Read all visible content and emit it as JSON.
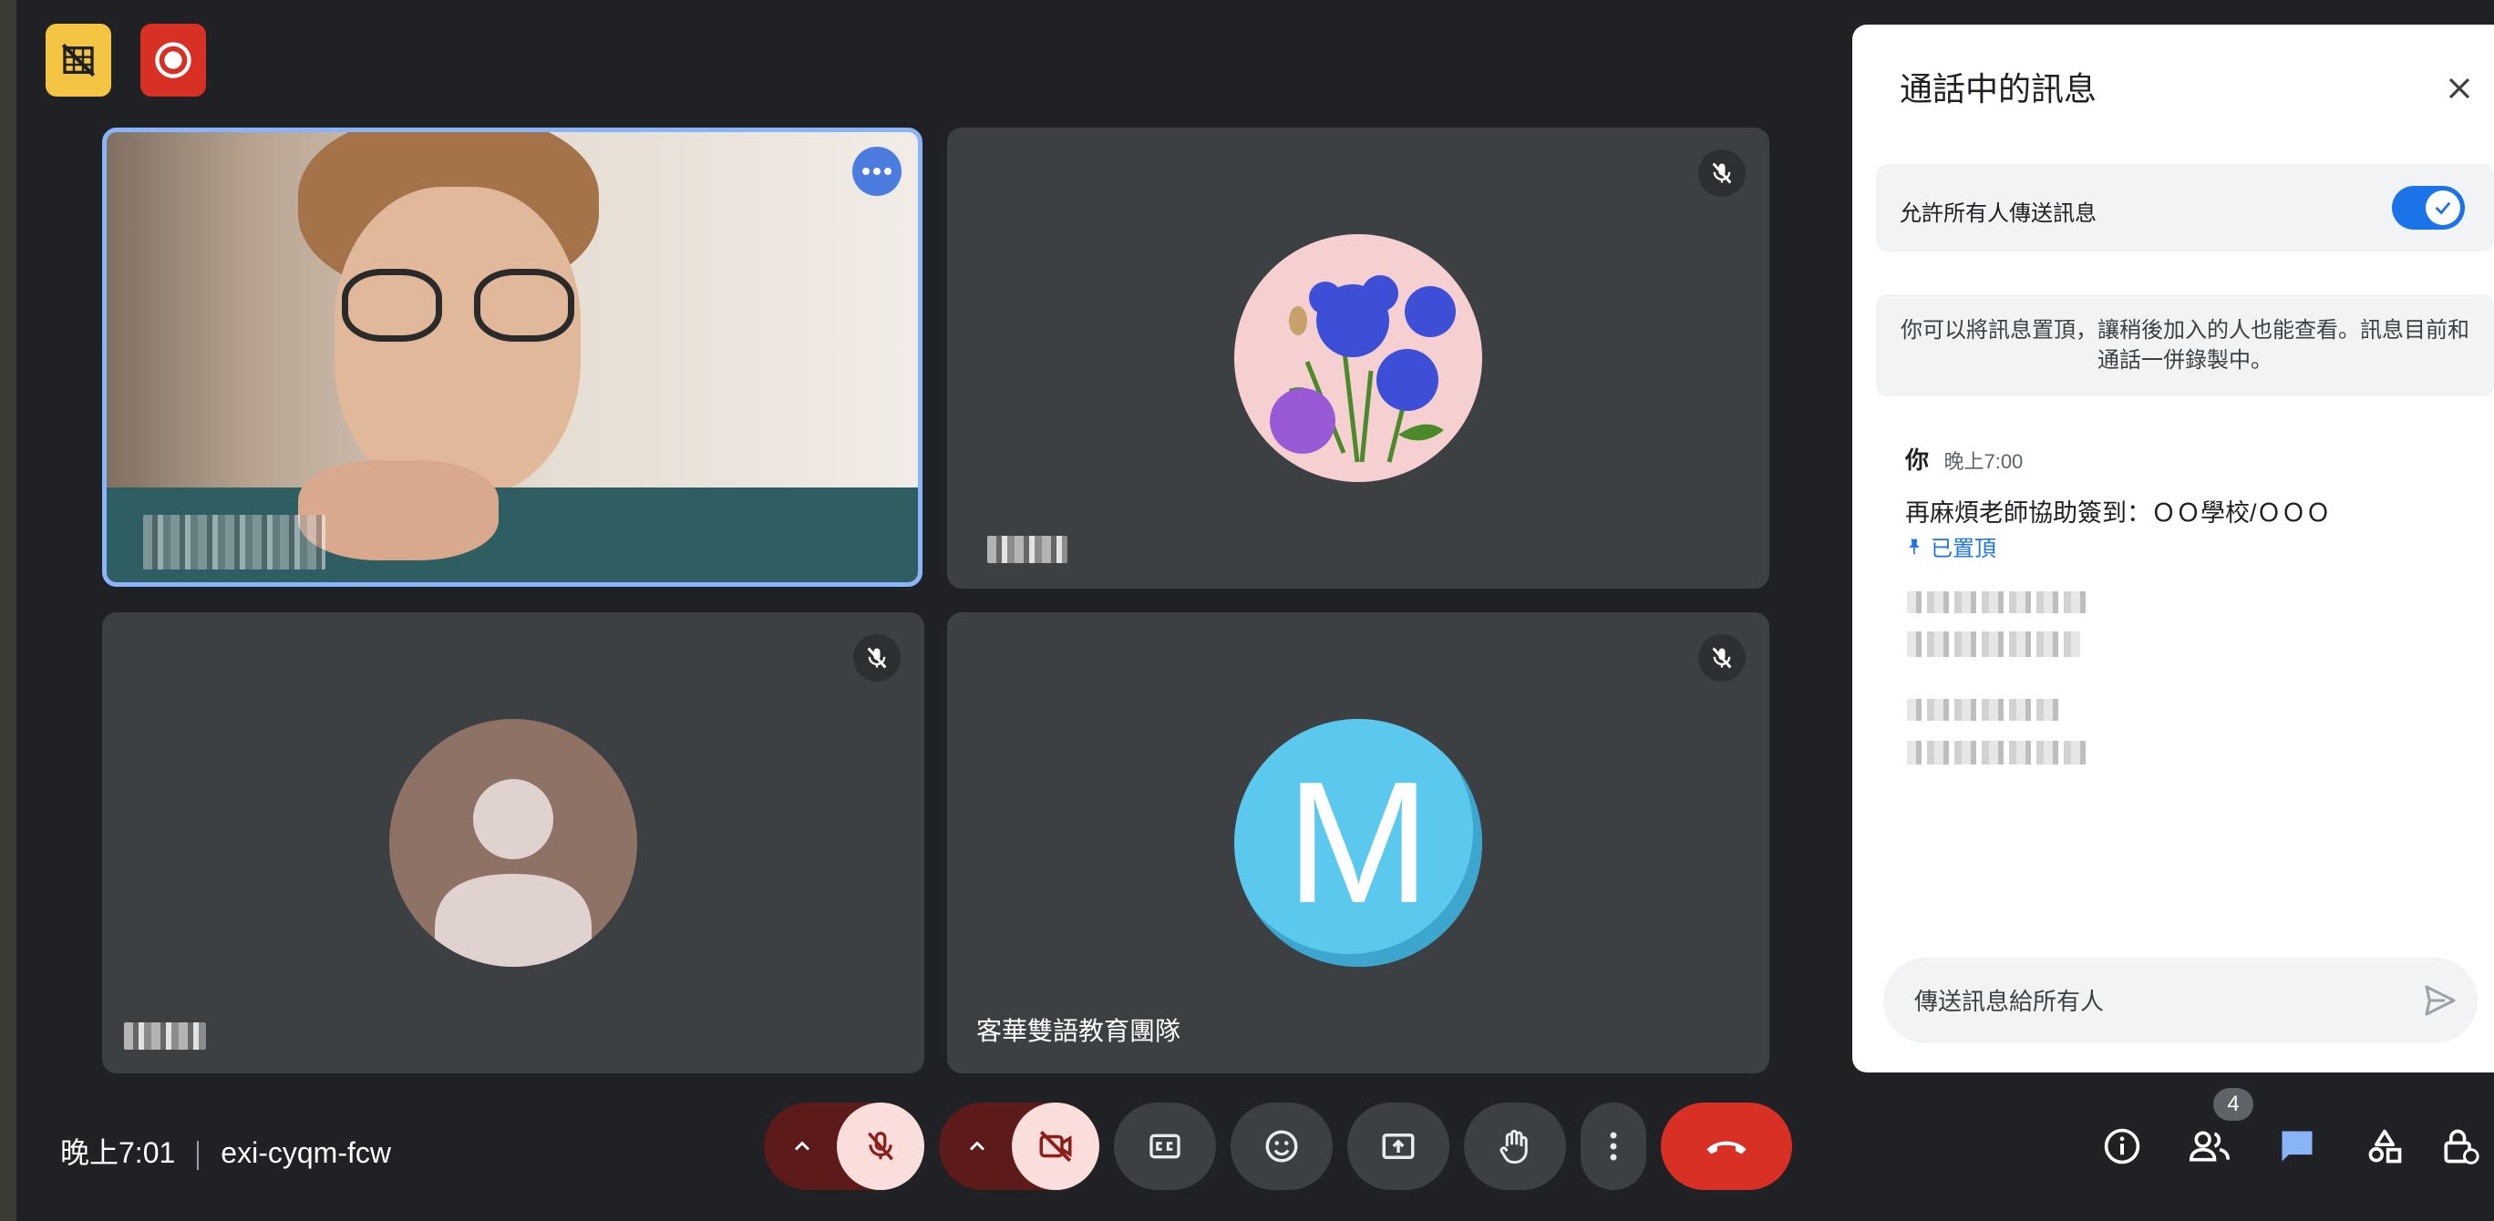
{
  "top_badges": [
    {
      "icon": "no-camera-grid-icon",
      "color": "#f4c542"
    },
    {
      "icon": "record-icon",
      "color": "#d93025"
    }
  ],
  "tiles": [
    {
      "name": "",
      "type": "video",
      "speaking": true,
      "icon": "more-options-icon"
    },
    {
      "name": "",
      "type": "avatar",
      "avatar": "cornflower-photo",
      "muted": true
    },
    {
      "name": "",
      "type": "avatar",
      "avatar": "default-person",
      "muted": true
    },
    {
      "name": "客華雙語教育團隊",
      "type": "avatar",
      "avatar_letter": "M",
      "avatar_color": "#5bc0eb",
      "muted": true
    }
  ],
  "chat_panel": {
    "title": "通話中的訊息",
    "allow_label": "允許所有人傳送訊息",
    "allow_enabled": true,
    "info_text": "你可以將訊息置頂，讓稍後加入的人也能查看。訊息目前和通話一併錄製中。",
    "message": {
      "sender": "你",
      "time": "晚上7:00",
      "text": "再麻煩老師協助簽到：ＯＯ學校/ＯＯＯ",
      "pinned_label": "已置頂"
    },
    "input_placeholder": "傳送訊息給所有人"
  },
  "bottom_bar": {
    "time": "晚上7:01",
    "meeting_code": "exi-cyqm-fcw",
    "controls": [
      "mic-off",
      "camera-off",
      "captions",
      "emoji",
      "present",
      "raise-hand",
      "more",
      "leave-call"
    ],
    "participant_count": "4",
    "right_icons": [
      "info-icon",
      "people-icon",
      "chat-icon",
      "activities-icon",
      "host-controls-icon"
    ],
    "colors": {
      "leave": "#d93025",
      "active_chat": "#8ab4f8",
      "muted_bg": "#f9dedc"
    }
  }
}
